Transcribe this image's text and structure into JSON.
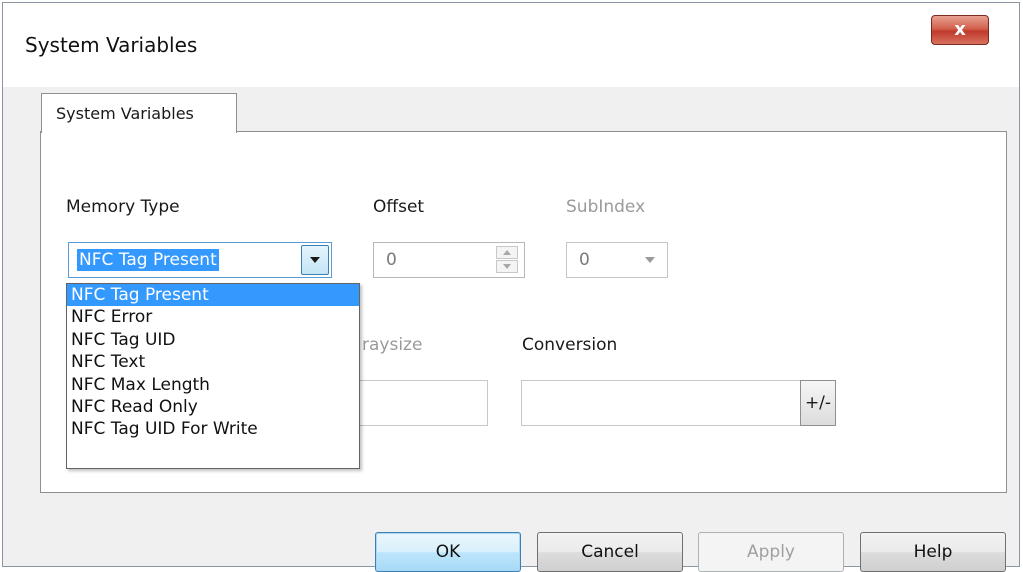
{
  "window": {
    "title": "System Variables",
    "close_glyph": "x"
  },
  "tabs": [
    {
      "label": "System Variables"
    }
  ],
  "form": {
    "memory_type_label": "Memory Type",
    "memory_type_value": "NFC Tag Present",
    "offset_label": "Offset",
    "offset_value": "0",
    "subindex_label": "SubIndex",
    "subindex_value": "0",
    "arraysize_label_visible": "raysize",
    "conversion_label": "Conversion",
    "conversion_value": "",
    "plus_minus_label": "+/-"
  },
  "dropdown": {
    "options": [
      "NFC Tag Present",
      "NFC Error",
      "NFC Tag UID",
      "NFC Text",
      "NFC Max Length",
      "NFC Read Only",
      "NFC Tag UID For Write"
    ],
    "selected_index": 0
  },
  "buttons": {
    "ok": "OK",
    "cancel": "Cancel",
    "apply": "Apply",
    "help": "Help"
  },
  "icons": {
    "close": "close-icon",
    "dropdown": "chevron-down-icon",
    "spin_up": "spin-up-icon",
    "spin_down": "spin-down-icon"
  },
  "colors": {
    "selection": "#3399ff",
    "close_button": "#c0392b",
    "default_button_border": "#3c7fb1"
  }
}
